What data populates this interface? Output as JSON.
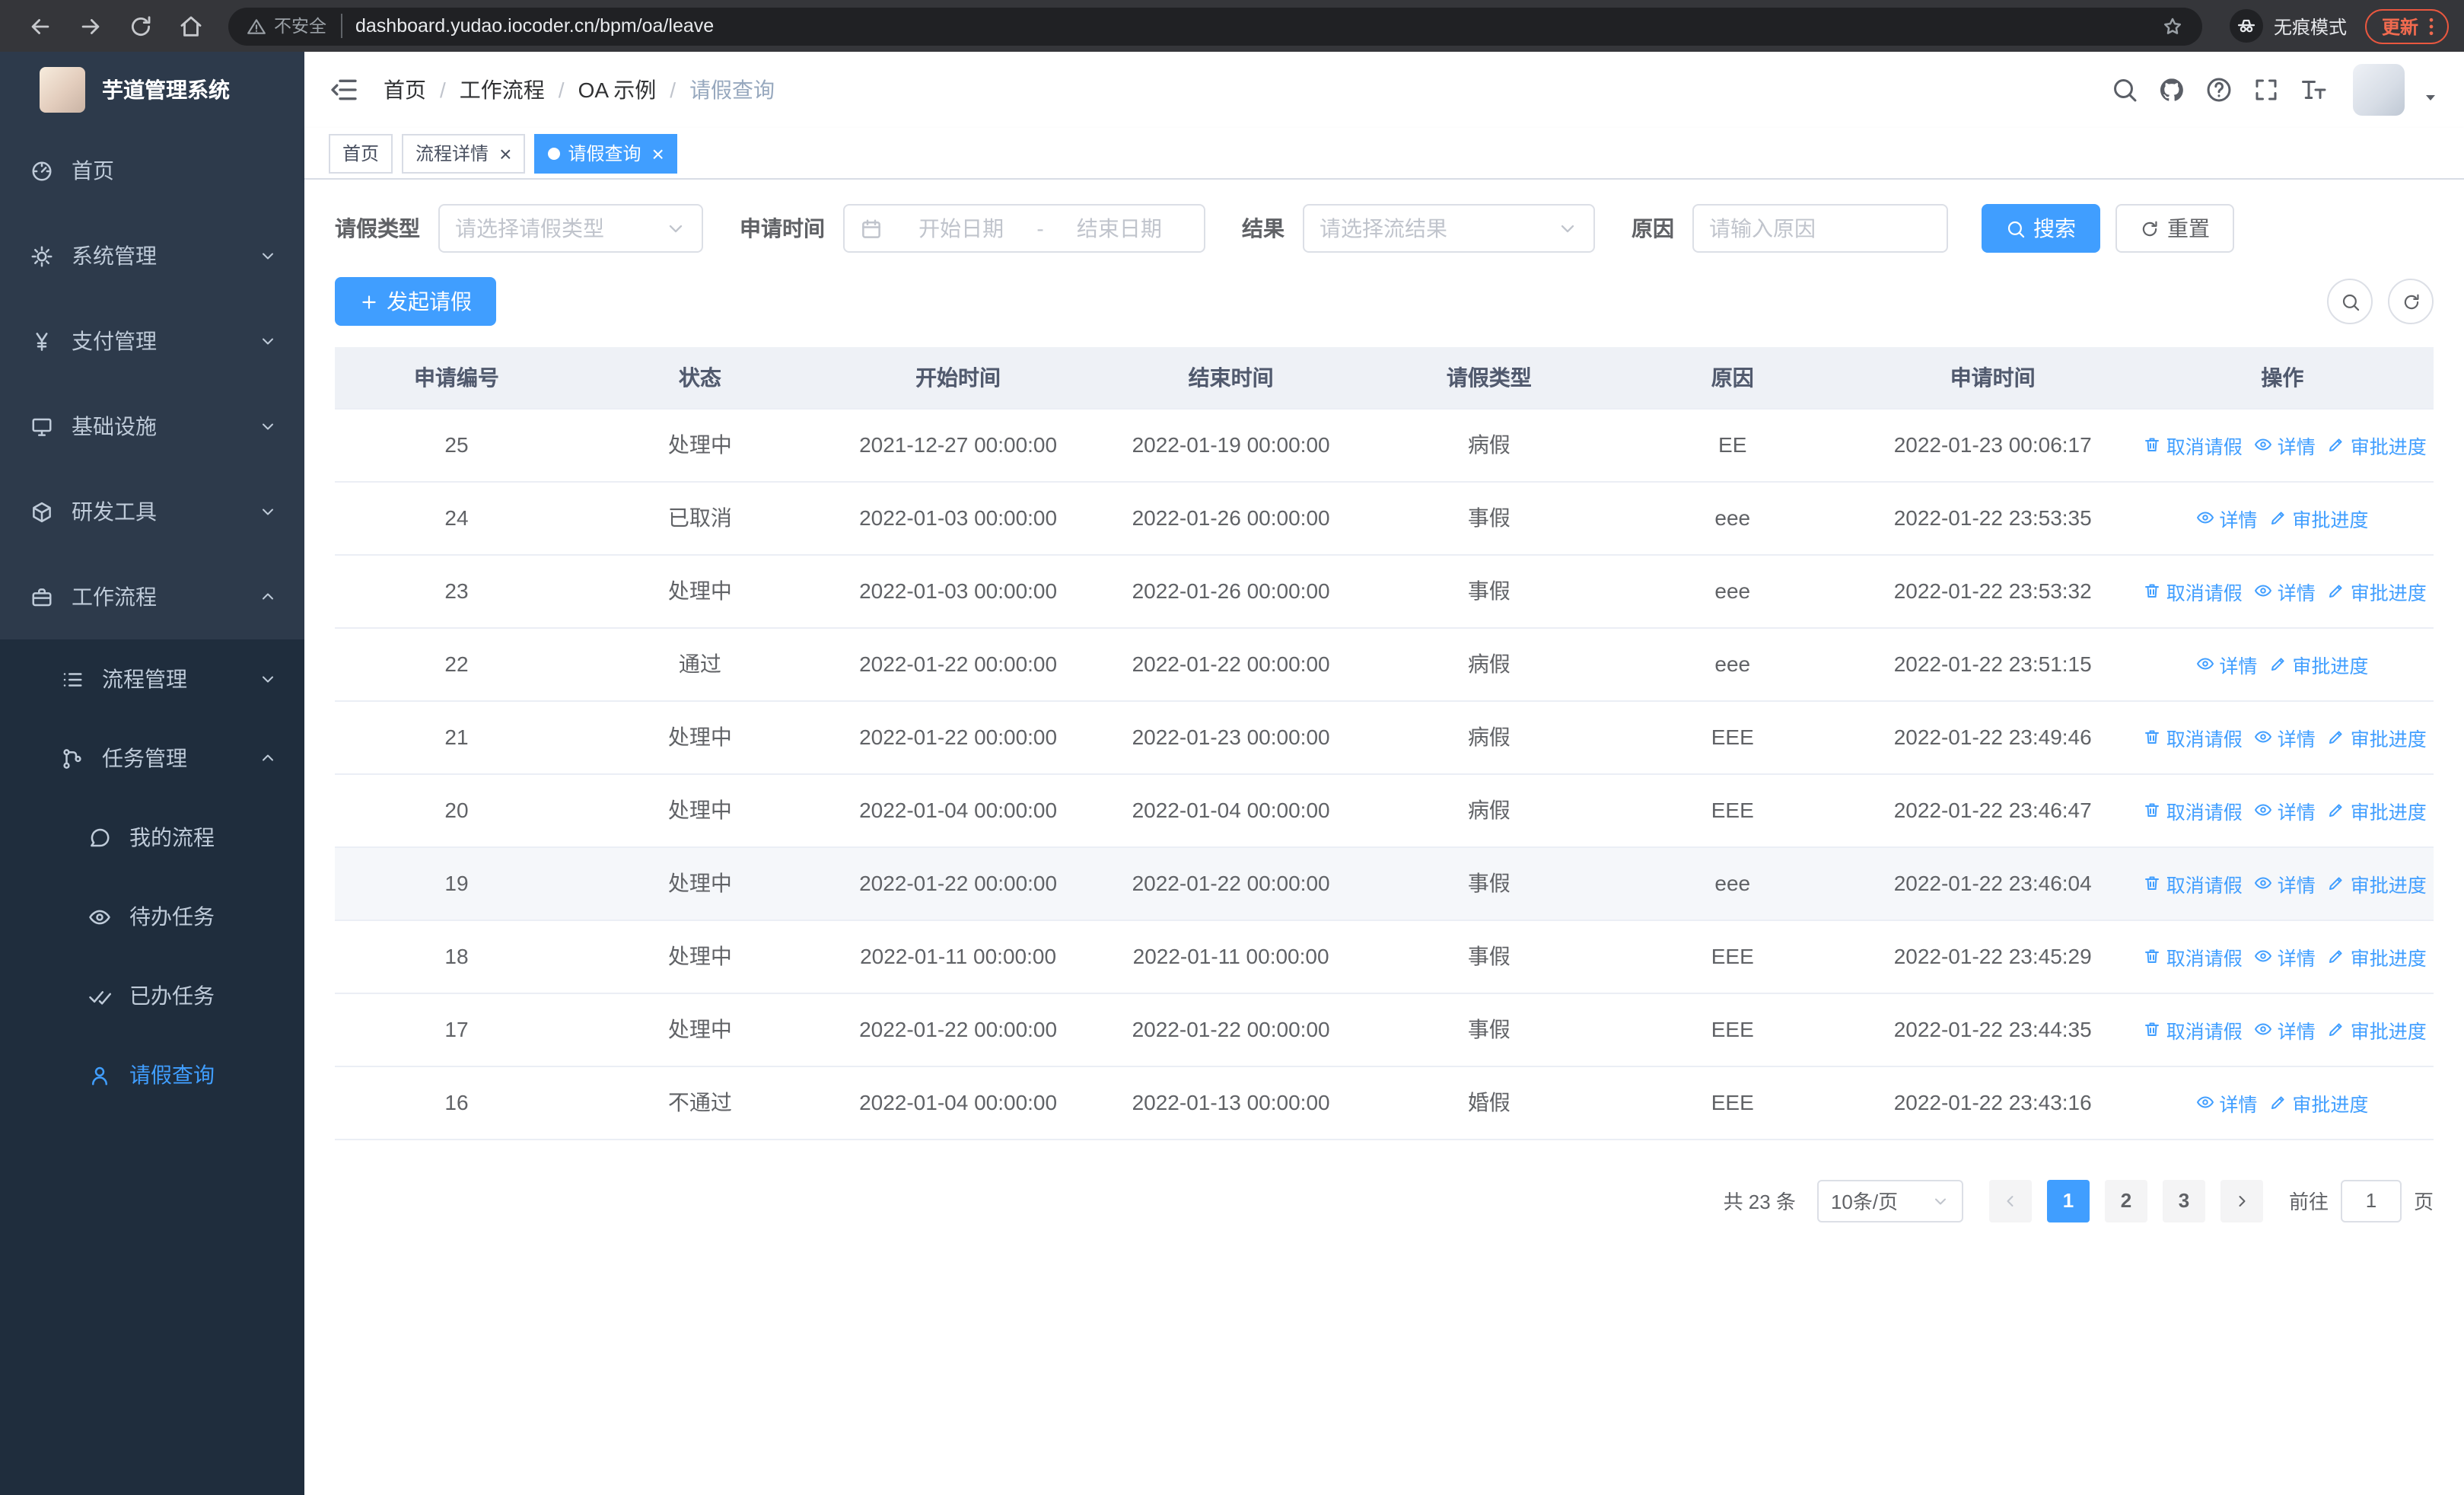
{
  "browser": {
    "security_label": "不安全",
    "url": "dashboard.yudao.iocoder.cn/bpm/oa/leave",
    "incognito_label": "无痕模式",
    "update_label": "更新"
  },
  "sidebar": {
    "app_title": "芋道管理系统",
    "menu": [
      {
        "key": "home",
        "label": "首页",
        "icon": "dashboard-icon",
        "level": 1
      },
      {
        "key": "system",
        "label": "系统管理",
        "icon": "gear-icon",
        "level": 1,
        "arrow": "down"
      },
      {
        "key": "payment",
        "label": "支付管理",
        "icon": "yen-icon",
        "level": 1,
        "arrow": "down"
      },
      {
        "key": "infrastructure",
        "label": "基础设施",
        "icon": "monitor-icon",
        "level": 1,
        "arrow": "down"
      },
      {
        "key": "dev-tools",
        "label": "研发工具",
        "icon": "toolbox-icon",
        "level": 1,
        "arrow": "down"
      },
      {
        "key": "workflow",
        "label": "工作流程",
        "icon": "briefcase-icon",
        "level": 1,
        "arrow": "up"
      },
      {
        "key": "process-mgmt",
        "label": "流程管理",
        "icon": "list-icon",
        "level": 2,
        "arrow": "down",
        "submenu": true
      },
      {
        "key": "task-mgmt",
        "label": "任务管理",
        "icon": "branch-icon",
        "level": 2,
        "arrow": "up",
        "submenu": true
      },
      {
        "key": "my-process",
        "label": "我的流程",
        "icon": "chat-icon",
        "level": 3,
        "submenu": true
      },
      {
        "key": "todo-task",
        "label": "待办任务",
        "icon": "eye-icon",
        "level": 3,
        "submenu": true
      },
      {
        "key": "done-task",
        "label": "已办任务",
        "icon": "double-check-icon",
        "level": 3,
        "submenu": true
      },
      {
        "key": "leave-query",
        "label": "请假查询",
        "icon": "user-icon",
        "level": 3,
        "submenu": true,
        "active": true
      }
    ]
  },
  "header": {
    "breadcrumb": [
      "首页",
      "工作流程",
      "OA 示例",
      "请假查询"
    ]
  },
  "tabs": [
    {
      "key": "home",
      "label": "首页",
      "closable": false,
      "active": false
    },
    {
      "key": "process-detail",
      "label": "流程详情",
      "closable": true,
      "active": false
    },
    {
      "key": "leave-query",
      "label": "请假查询",
      "closable": true,
      "active": true
    }
  ],
  "filters": {
    "leave_type_label": "请假类型",
    "leave_type_placeholder": "请选择请假类型",
    "apply_time_label": "申请时间",
    "start_date_placeholder": "开始日期",
    "range_separator": "-",
    "end_date_placeholder": "结束日期",
    "result_label": "结果",
    "result_placeholder": "请选择流结果",
    "reason_label": "原因",
    "reason_placeholder": "请输入原因",
    "search_label": "搜索",
    "reset_label": "重置"
  },
  "toolbar": {
    "create_label": "发起请假"
  },
  "table": {
    "columns": [
      "申请编号",
      "状态",
      "开始时间",
      "结束时间",
      "请假类型",
      "原因",
      "申请时间",
      "操作"
    ],
    "action_labels": {
      "cancel": "取消请假",
      "detail": "详情",
      "progress": "审批进度"
    },
    "rows": [
      {
        "id": "25",
        "status": "处理中",
        "start": "2021-12-27 00:00:00",
        "end": "2022-01-19 00:00:00",
        "type": "病假",
        "reason": "EE",
        "applied": "2022-01-23 00:06:17",
        "actions": [
          "cancel",
          "detail",
          "progress"
        ]
      },
      {
        "id": "24",
        "status": "已取消",
        "start": "2022-01-03 00:00:00",
        "end": "2022-01-26 00:00:00",
        "type": "事假",
        "reason": "eee",
        "applied": "2022-01-22 23:53:35",
        "actions": [
          "detail",
          "progress"
        ]
      },
      {
        "id": "23",
        "status": "处理中",
        "start": "2022-01-03 00:00:00",
        "end": "2022-01-26 00:00:00",
        "type": "事假",
        "reason": "eee",
        "applied": "2022-01-22 23:53:32",
        "actions": [
          "cancel",
          "detail",
          "progress"
        ]
      },
      {
        "id": "22",
        "status": "通过",
        "start": "2022-01-22 00:00:00",
        "end": "2022-01-22 00:00:00",
        "type": "病假",
        "reason": "eee",
        "applied": "2022-01-22 23:51:15",
        "actions": [
          "detail",
          "progress"
        ]
      },
      {
        "id": "21",
        "status": "处理中",
        "start": "2022-01-22 00:00:00",
        "end": "2022-01-23 00:00:00",
        "type": "病假",
        "reason": "EEE",
        "applied": "2022-01-22 23:49:46",
        "actions": [
          "cancel",
          "detail",
          "progress"
        ]
      },
      {
        "id": "20",
        "status": "处理中",
        "start": "2022-01-04 00:00:00",
        "end": "2022-01-04 00:00:00",
        "type": "病假",
        "reason": "EEE",
        "applied": "2022-01-22 23:46:47",
        "actions": [
          "cancel",
          "detail",
          "progress"
        ]
      },
      {
        "id": "19",
        "status": "处理中",
        "start": "2022-01-22 00:00:00",
        "end": "2022-01-22 00:00:00",
        "type": "事假",
        "reason": "eee",
        "applied": "2022-01-22 23:46:04",
        "actions": [
          "cancel",
          "detail",
          "progress"
        ],
        "highlighted": true
      },
      {
        "id": "18",
        "status": "处理中",
        "start": "2022-01-11 00:00:00",
        "end": "2022-01-11 00:00:00",
        "type": "事假",
        "reason": "EEE",
        "applied": "2022-01-22 23:45:29",
        "actions": [
          "cancel",
          "detail",
          "progress"
        ]
      },
      {
        "id": "17",
        "status": "处理中",
        "start": "2022-01-22 00:00:00",
        "end": "2022-01-22 00:00:00",
        "type": "事假",
        "reason": "EEE",
        "applied": "2022-01-22 23:44:35",
        "actions": [
          "cancel",
          "detail",
          "progress"
        ]
      },
      {
        "id": "16",
        "status": "不通过",
        "start": "2022-01-04 00:00:00",
        "end": "2022-01-13 00:00:00",
        "type": "婚假",
        "reason": "EEE",
        "applied": "2022-01-22 23:43:16",
        "actions": [
          "detail",
          "progress"
        ]
      }
    ]
  },
  "pagination": {
    "total_label": "共 23 条",
    "page_size_label": "10条/页",
    "pages": [
      "1",
      "2",
      "3"
    ],
    "active_page": "1",
    "goto_label": "前往",
    "goto_value": "1",
    "page_unit_label": "页"
  },
  "colors": {
    "primary": "#409eff",
    "sidebar_bg": "#2d3a4b",
    "submenu_bg": "#1f2d3d",
    "update_chip": "#e9573f"
  }
}
